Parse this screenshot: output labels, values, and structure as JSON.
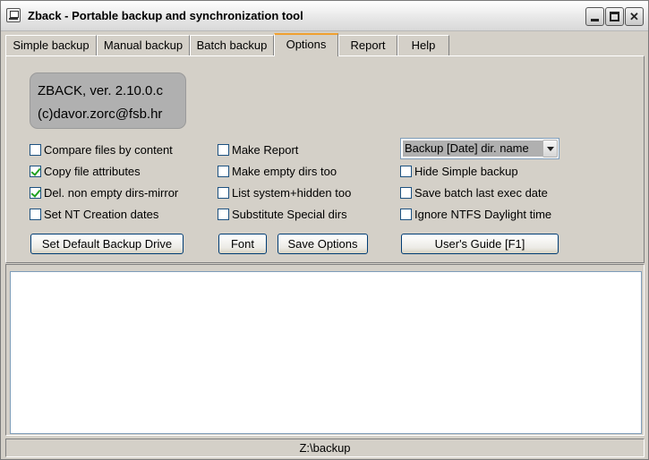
{
  "window": {
    "title": "Zback - Portable backup and synchronization tool"
  },
  "tabs": [
    {
      "label": "Simple backup"
    },
    {
      "label": "Manual backup"
    },
    {
      "label": "Batch backup"
    },
    {
      "label": "Options",
      "active": true
    },
    {
      "label": "Report"
    },
    {
      "label": "Help"
    }
  ],
  "version": {
    "line1": "ZBACK, ver. 2.10.0.c",
    "line2": "(c)davor.zorc@fsb.hr"
  },
  "options": {
    "col1": [
      {
        "label": "Compare files by content",
        "checked": false
      },
      {
        "label": "Copy file attributes",
        "checked": true
      },
      {
        "label": "Del. non empty dirs-mirror",
        "checked": true
      },
      {
        "label": "Set NT Creation dates",
        "checked": false
      }
    ],
    "col2": [
      {
        "label": "Make Report",
        "checked": false
      },
      {
        "label": "Make empty dirs too",
        "checked": false
      },
      {
        "label": "List system+hidden too",
        "checked": false
      },
      {
        "label": "Substitute Special dirs",
        "checked": false
      }
    ],
    "col3": [
      {
        "label": "Hide Simple backup",
        "checked": false
      },
      {
        "label": "Save batch last exec date",
        "checked": false
      },
      {
        "label": "Ignore NTFS Daylight time",
        "checked": false
      }
    ],
    "dir_name_select": "Backup [Date] dir. name"
  },
  "buttons": {
    "set_default_drive": "Set Default Backup Drive",
    "font": "Font",
    "save_options": "Save Options",
    "users_guide": "User's Guide  [F1]"
  },
  "log": {
    "content": ""
  },
  "status": {
    "path": "Z:\\backup"
  },
  "colors": {
    "window_bg": "#d4d0c8",
    "version_box_bg": "#b0b0b0",
    "active_tab_accent": "#f0a030",
    "check_mark": "#21a121"
  }
}
